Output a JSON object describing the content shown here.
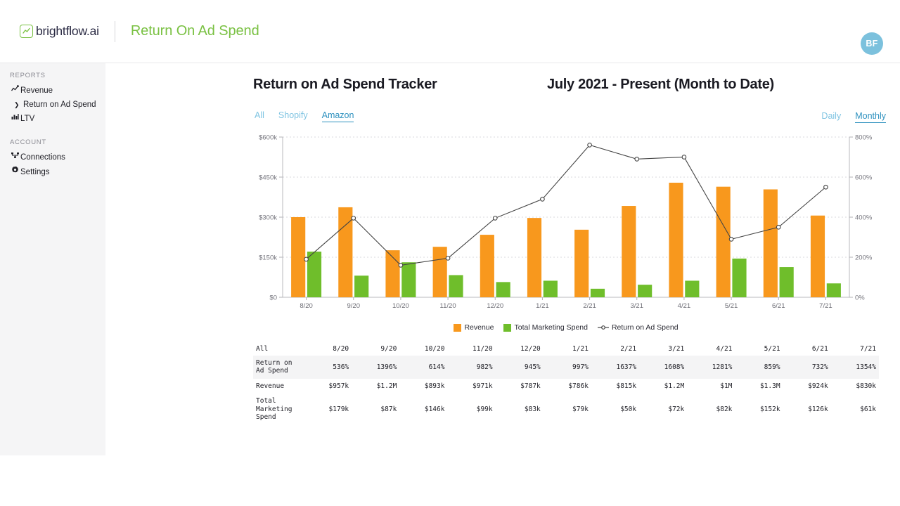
{
  "topbar": {
    "brand_name": "brightflow.ai",
    "brand_icon": "line-chart-icon",
    "page_title": "Return On Ad Spend",
    "avatar_initials": "BF"
  },
  "sidebar": {
    "sections": [
      {
        "label": "REPORTS",
        "items": [
          {
            "label": "Revenue",
            "icon": "line-chart-icon",
            "active": false
          },
          {
            "label": "Return on Ad Spend",
            "icon": "chevron-right-icon",
            "active": true
          },
          {
            "label": "LTV",
            "icon": "bar-chart-icon",
            "active": false
          }
        ]
      },
      {
        "label": "ACCOUNT",
        "items": [
          {
            "label": "Connections",
            "icon": "connections-icon",
            "active": false
          },
          {
            "label": "Settings",
            "icon": "gear-icon",
            "active": false
          }
        ]
      }
    ]
  },
  "main": {
    "chart_title": "Return on Ad Spend Tracker",
    "date_range": "July 2021 - Present (Month to Date)",
    "source_tabs": [
      {
        "label": "All",
        "active": false
      },
      {
        "label": "Shopify",
        "active": false
      },
      {
        "label": "Amazon",
        "active": true
      }
    ],
    "granularity_tabs": [
      {
        "label": "Daily",
        "active": false
      },
      {
        "label": "Monthly",
        "active": true
      }
    ]
  },
  "colors": {
    "revenue": "#f8981d",
    "marketing_spend": "#6fbe2b",
    "roas_line": "#444444",
    "brand_green": "#7ac143",
    "tab_active": "#2e91bf",
    "tab_inactive": "#7fc4e2",
    "avatar_bg": "#7cc1dd"
  },
  "chart_data": {
    "type": "bar",
    "title": "Return on Ad Spend Tracker",
    "subtitle": "July 2021 - Present (Month to Date)",
    "xlabel": "",
    "ylabel": "",
    "grid": true,
    "legend_position": "bottom",
    "categories": [
      "8/20",
      "9/20",
      "10/20",
      "11/20",
      "12/20",
      "1/21",
      "2/21",
      "3/21",
      "4/21",
      "5/21",
      "6/21",
      "7/21"
    ],
    "left_axis": {
      "ticks": [
        "$0",
        "$150k",
        "$300k",
        "$450k",
        "$600k"
      ],
      "values": [
        0,
        150000,
        300000,
        450000,
        600000
      ],
      "ylim": [
        0,
        600000
      ]
    },
    "right_axis": {
      "ticks": [
        "0%",
        "200%",
        "400%",
        "600%",
        "800%"
      ],
      "values": [
        0,
        200,
        400,
        600,
        800
      ],
      "ylim": [
        0,
        800
      ]
    },
    "series": [
      {
        "name": "Revenue",
        "type": "bar",
        "axis": "left",
        "color": "#f8981d",
        "values": [
          300000,
          337000,
          176000,
          189000,
          234000,
          297000,
          253000,
          342000,
          429000,
          414000,
          404000,
          306000
        ],
        "labels": [
          "$957k",
          "$1.2M",
          "$893k",
          "$971k",
          "$787k",
          "$786k",
          "$815k",
          "$1.2M",
          "$1M",
          "$1.3M",
          "$924k",
          "$830k"
        ]
      },
      {
        "name": "Total Marketing Spend",
        "type": "bar",
        "axis": "left",
        "color": "#6fbe2b",
        "values": [
          171000,
          81000,
          131000,
          83000,
          57000,
          62000,
          32000,
          47000,
          62000,
          145000,
          113000,
          52000
        ],
        "labels": [
          "$179k",
          "$87k",
          "$146k",
          "$99k",
          "$83k",
          "$79k",
          "$50k",
          "$72k",
          "$82k",
          "$152k",
          "$126k",
          "$61k"
        ]
      },
      {
        "name": "Return on Ad Spend",
        "type": "line",
        "axis": "right",
        "color": "#444444",
        "values": [
          190,
          395,
          160,
          195,
          395,
          490,
          760,
          690,
          700,
          290,
          350,
          550
        ],
        "labels": [
          "536%",
          "1396%",
          "614%",
          "982%",
          "945%",
          "997%",
          "1637%",
          "1608%",
          "1281%",
          "859%",
          "732%",
          "1354%"
        ]
      }
    ]
  },
  "table": {
    "corner_label": "All",
    "columns": [
      "8/20",
      "9/20",
      "10/20",
      "11/20",
      "12/20",
      "1/21",
      "2/21",
      "3/21",
      "4/21",
      "5/21",
      "6/21",
      "7/21"
    ],
    "rows": [
      {
        "label": "Return on Ad Spend",
        "shaded": true,
        "values": [
          "536%",
          "1396%",
          "614%",
          "982%",
          "945%",
          "997%",
          "1637%",
          "1608%",
          "1281%",
          "859%",
          "732%",
          "1354%"
        ]
      },
      {
        "label": "Revenue",
        "shaded": false,
        "values": [
          "$957k",
          "$1.2M",
          "$893k",
          "$971k",
          "$787k",
          "$786k",
          "$815k",
          "$1.2M",
          "$1M",
          "$1.3M",
          "$924k",
          "$830k"
        ]
      },
      {
        "label": "Total Marketing Spend",
        "shaded": false,
        "values": [
          "$179k",
          "$87k",
          "$146k",
          "$99k",
          "$83k",
          "$79k",
          "$50k",
          "$72k",
          "$82k",
          "$152k",
          "$126k",
          "$61k"
        ]
      }
    ]
  }
}
